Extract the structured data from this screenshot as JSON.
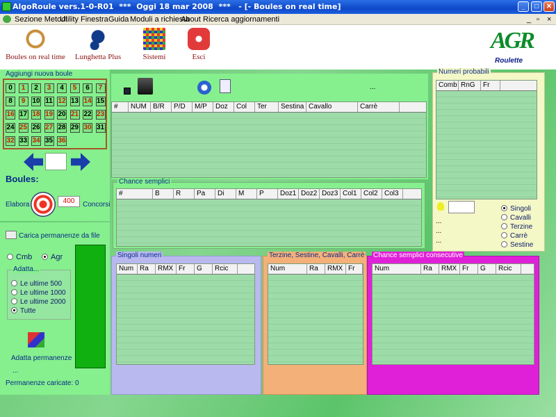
{
  "window": {
    "title": "AlgoRoule vers.1-0-R01  ***  Oggi 18 mar 2008  ***   - [- Boules on real time]"
  },
  "menu": [
    "Sezione Metodi",
    "Utility",
    "Finestra",
    "Guida",
    "Moduli a richiesta",
    "About",
    "Ricerca aggiornamenti"
  ],
  "toolbar": [
    {
      "label": "Boules on real time",
      "icon": "clock-icon"
    },
    {
      "label": "Lunghetta Plus",
      "icon": "lottery-icon"
    },
    {
      "label": "Sistemi",
      "icon": "grid-icon"
    },
    {
      "label": "Esci",
      "icon": "power-icon"
    }
  ],
  "logo": {
    "letters": "AGR",
    "sub": "Roulette"
  },
  "aggiungi": {
    "legend": "Aggiungi nuova boule",
    "numbers": [
      "0",
      "1",
      "2",
      "3",
      "4",
      "5",
      "6",
      "7",
      "8",
      "9",
      "10",
      "11",
      "12",
      "13",
      "14",
      "15",
      "16",
      "17",
      "18",
      "19",
      "20",
      "21",
      "22",
      "23",
      "24",
      "25",
      "26",
      "27",
      "28",
      "29",
      "30",
      "31",
      "32",
      "33",
      "34",
      "35",
      "36"
    ],
    "red": [
      1,
      3,
      5,
      7,
      9,
      12,
      14,
      16,
      18,
      19,
      21,
      23,
      25,
      27,
      30,
      32,
      34,
      36
    ]
  },
  "boules": {
    "label": "Boules:",
    "elabora": "Elabora",
    "value": "400",
    "concorsi": "Concorsi"
  },
  "carica": {
    "label": "Carica permanenze da file"
  },
  "mode": {
    "options": [
      "Cmb",
      "Agr"
    ],
    "selected": "Agr"
  },
  "adatta": {
    "legend": "Adatta...",
    "options": [
      "Le ultime 500",
      "Le ultime 1000",
      "Le ultime 2000",
      "Tutte"
    ],
    "selected": "Tutte",
    "button": "Adatta permanenze",
    "dots": "...",
    "status": "Permanenze caricate: 0"
  },
  "top_grid": {
    "dots": "...",
    "columns": [
      "#",
      "NUM",
      "B/R",
      "P/D",
      "M/P",
      "Doz",
      "Col",
      "Ter",
      "Sestina",
      "Cavallo",
      "Carrè"
    ]
  },
  "chance_semplici": {
    "legend": "Chance semplici",
    "columns": [
      "#",
      "B",
      "R",
      "Pa",
      "Di",
      "M",
      "P",
      "Doz1",
      "Doz2",
      "Doz3",
      "Col1",
      "Col2",
      "Col3"
    ]
  },
  "numeri_probabili": {
    "legend": "Numeri probabili",
    "columns": [
      "Comb",
      "RnG",
      "Fr"
    ],
    "options": [
      "Singoli",
      "Cavalli",
      "Terzine",
      "Carrè",
      "Sestine"
    ],
    "selected": "Singoli",
    "dots": [
      "...",
      "...",
      "..."
    ]
  },
  "singoli": {
    "legend": "Singoli numeri",
    "columns": [
      "Num",
      "Ra",
      "RMX",
      "Fr",
      "G",
      "Rcic"
    ],
    "color": "#b9b9f0"
  },
  "terzine": {
    "legend": "Terzine, Sestine, Cavalli, Carrè",
    "columns": [
      "Num",
      "Ra",
      "RMX",
      "Fr"
    ],
    "color": "#f3b078"
  },
  "consecutive": {
    "legend": "Chance semplici consecutive",
    "columns": [
      "Num",
      "Ra",
      "RMX",
      "Fr",
      "G",
      "Rcic"
    ],
    "color": "#e020d8"
  }
}
